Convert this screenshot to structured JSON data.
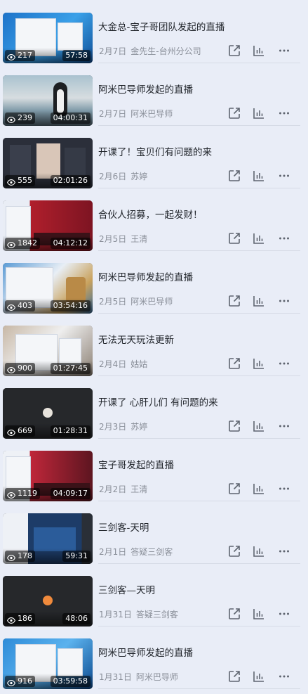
{
  "colors": {
    "background": "#e9edf7",
    "title": "#1f2329",
    "meta": "#8a8f99",
    "icon": "#5f6570",
    "divider": "#d6dbe6"
  },
  "actions": {
    "share_icon": "share-icon",
    "stats_icon": "bar-chart-icon",
    "more_icon": "more-icon"
  },
  "items": [
    {
      "title": "大金总-宝子哥团队发起的直播",
      "date": "2月7日",
      "author": "金先生-台州分公司",
      "views": "217",
      "duration": "57:58",
      "scene": "sc-desktop-blue"
    },
    {
      "title": "阿米巴导师发起的直播",
      "date": "2月7日",
      "author": "阿米巴导师",
      "views": "239",
      "duration": "04:00:31",
      "scene": "sc-penguin"
    },
    {
      "title": "开课了！宝贝们有问题的来",
      "date": "2月6日",
      "author": "苏婷",
      "views": "555",
      "duration": "02:01:26",
      "scene": "sc-dark-app"
    },
    {
      "title": "合伙人招募，一起发财！",
      "date": "2月5日",
      "author": "王清",
      "views": "1842",
      "duration": "04:12:12",
      "scene": "sc-stage"
    },
    {
      "title": "阿米巴导师发起的直播",
      "date": "2月5日",
      "author": "阿米巴导师",
      "views": "403",
      "duration": "03:54:16",
      "scene": "sc-landscape"
    },
    {
      "title": "无法无天玩法更新",
      "date": "2月4日",
      "author": "姑姑",
      "views": "900",
      "duration": "01:27:45",
      "scene": "sc-rocks"
    },
    {
      "title": "开课了 心肝儿们 有问题的来",
      "date": "2月3日",
      "author": "苏婷",
      "views": "669",
      "duration": "01:28:31",
      "scene": "sc-black"
    },
    {
      "title": "宝子哥发起的直播",
      "date": "2月2日",
      "author": "王清",
      "views": "1119",
      "duration": "04:09:17",
      "scene": "sc-stage2"
    },
    {
      "title": "三剑客-天明",
      "date": "2月1日",
      "author": "答疑三剑客",
      "views": "178",
      "duration": "59:31",
      "scene": "sc-screen"
    },
    {
      "title": "三剑客—天明",
      "date": "1月31日",
      "author": "答疑三剑客",
      "views": "186",
      "duration": "48:06",
      "scene": "sc-black2"
    },
    {
      "title": "阿米巴导师发起的直播",
      "date": "1月31日",
      "author": "阿米巴导师",
      "views": "916",
      "duration": "03:59:58",
      "scene": "sc-desktop2"
    }
  ]
}
